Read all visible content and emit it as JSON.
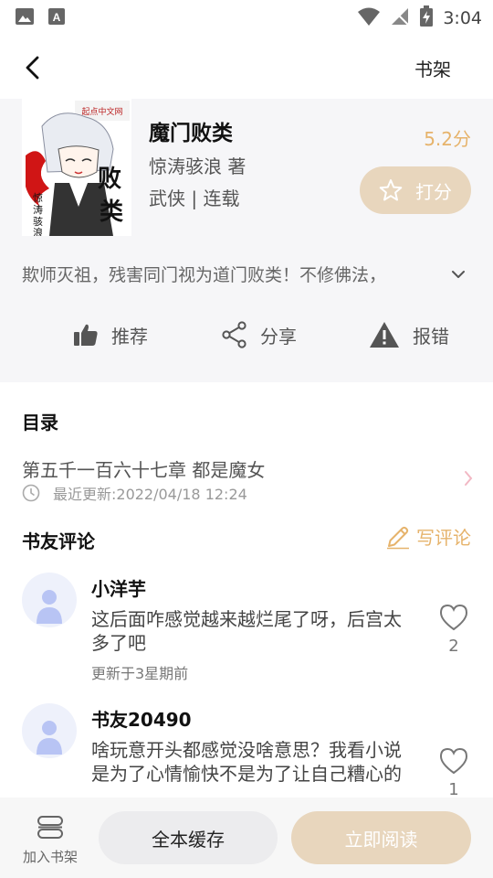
{
  "status_bar": {
    "time": "3:04"
  },
  "top_bar": {
    "shelf_label": "书架"
  },
  "book": {
    "title": "魔门败类",
    "author": "惊涛骇浪 著",
    "tags": "武侠 | 连载",
    "score": "5.2分",
    "rate_label": "打分",
    "synopsis": "欺师灭祖，残害同门视为道门败类！不修佛法，",
    "cover": {
      "title": "魔门败类",
      "author": "惊涛骇浪",
      "publisher": "起点中文网"
    }
  },
  "actions": [
    {
      "label": "推荐",
      "icon": "thumbs-up-icon"
    },
    {
      "label": "分享",
      "icon": "share-icon"
    },
    {
      "label": "报错",
      "icon": "warning-icon"
    }
  ],
  "catalog": {
    "title": "目录",
    "latest_chapter": "第五千一百六十七章 都是魔女",
    "updated": "最近更新:2022/04/18 12:24"
  },
  "reviews": {
    "title": "书友评论",
    "write_label": "写评论",
    "items": [
      {
        "name": "小洋芋",
        "text": "这后面咋感觉越来越烂尾了呀，后宫太多了吧",
        "time": "更新于3星期前",
        "likes": "2"
      },
      {
        "name": "书友20490",
        "text": "啥玩意开头都感觉没啥意思？我看小说是为了心情愉快不是为了让自己糟心的",
        "likes": "1"
      }
    ]
  },
  "bottom_bar": {
    "add_shelf_label": "加入书架",
    "cache_label": "全本缓存",
    "read_label": "立即阅读"
  },
  "colors": {
    "accent": "#e6b36b",
    "button_beige": "#e8d6bd",
    "panel_bg": "#f6f6f8"
  }
}
